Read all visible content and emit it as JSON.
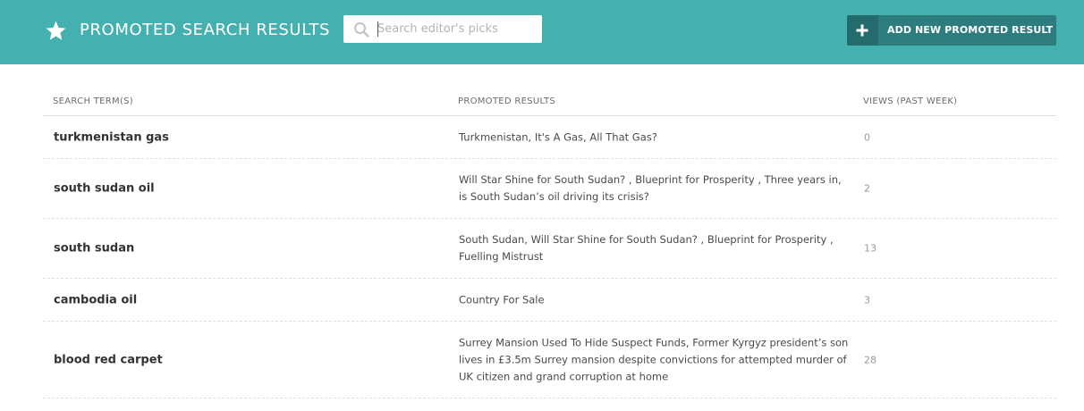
{
  "header": {
    "title": "PROMOTED SEARCH RESULTS",
    "title_icon": "star-icon",
    "search": {
      "placeholder": "Search editor's picks",
      "value": "",
      "icon": "search-icon"
    },
    "add_button": {
      "label": "ADD NEW PROMOTED RESULT",
      "icon": "plus-icon"
    }
  },
  "colors": {
    "header_bg": "#44b1b0",
    "button_bg": "#2e7d7e",
    "button_icon_bg": "#236b6c"
  },
  "table": {
    "columns": [
      "SEARCH TERM(S)",
      "PROMOTED RESULTS",
      "VIEWS (PAST WEEK)"
    ],
    "rows": [
      {
        "term": "turkmenistan gas",
        "results": "Turkmenistan, It's A Gas, All That Gas?",
        "views": "0"
      },
      {
        "term": "south sudan oil",
        "results": "Will Star Shine for South Sudan? , Blueprint for Prosperity , Three years in, is South Sudan’s oil driving its crisis?",
        "views": "2"
      },
      {
        "term": "south sudan",
        "results": "South Sudan, Will Star Shine for South Sudan? , Blueprint for Prosperity , Fuelling Mistrust",
        "views": "13"
      },
      {
        "term": "cambodia oil",
        "results": "Country For Sale",
        "views": "3"
      },
      {
        "term": "blood red carpet",
        "results": "Surrey Mansion Used To Hide Suspect Funds, Former Kyrgyz president’s son lives in £3.5m Surrey mansion despite convictions for attempted murder of UK citizen and grand corruption at home",
        "views": "28"
      }
    ]
  }
}
